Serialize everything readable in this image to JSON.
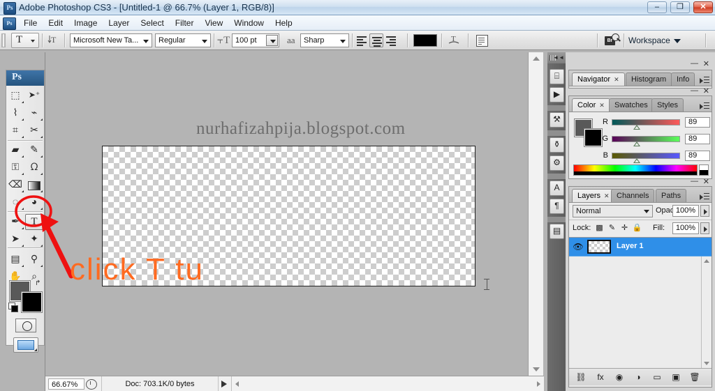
{
  "window": {
    "title": "Adobe Photoshop CS3 - [Untitled-1 @ 66.7% (Layer 1, RGB/8)]",
    "app_icon": "Ps",
    "minimize": "–",
    "restore": "❐",
    "close": "✕"
  },
  "menubar": {
    "app_icon": "Ps",
    "items": [
      "File",
      "Edit",
      "Image",
      "Layer",
      "Select",
      "Filter",
      "View",
      "Window",
      "Help"
    ]
  },
  "options_bar": {
    "tool_glyph": "T",
    "orientation_icon": "⇅T",
    "font_family": "Microsoft New Ta...",
    "font_style": "Regular",
    "size_icon": "⫟T",
    "font_size": "100 pt",
    "aa_icon": "aa",
    "anti_alias": "Sharp",
    "align_left": "align-left",
    "align_center": "align-center",
    "align_right": "align-right",
    "text_color": "#000000",
    "warp_icon": "warp-text",
    "palette_icon": "character-paragraph-panels",
    "bridge_label": "Br",
    "workspace_label": "Workspace"
  },
  "toolbox": {
    "header": "Ps",
    "tools": [
      {
        "name": "marquee-tool",
        "glyph": "▭",
        "menu": true,
        "selected": false
      },
      {
        "name": "move-tool",
        "glyph": "➤",
        "menu": false,
        "selected": false
      },
      {
        "name": "lasso-tool",
        "glyph": "✐",
        "menu": true,
        "selected": false
      },
      {
        "name": "magic-wand-tool",
        "glyph": "✧",
        "menu": true,
        "selected": false
      },
      {
        "name": "crop-tool",
        "glyph": "⌗",
        "menu": false,
        "selected": false
      },
      {
        "name": "slice-tool",
        "glyph": "✂",
        "menu": true,
        "selected": false
      },
      {
        "name": "healing-brush-tool",
        "glyph": "▰",
        "menu": true,
        "selected": false
      },
      {
        "name": "brush-tool",
        "glyph": "✎",
        "menu": true,
        "selected": false
      },
      {
        "name": "clone-stamp-tool",
        "glyph": "⚒",
        "menu": true,
        "selected": false
      },
      {
        "name": "history-brush-tool",
        "glyph": "ᘯ",
        "menu": true,
        "selected": false
      },
      {
        "name": "eraser-tool",
        "glyph": "◳",
        "menu": true,
        "selected": false
      },
      {
        "name": "gradient-tool",
        "glyph": "▤",
        "menu": true,
        "selected": false
      },
      {
        "name": "blur-tool",
        "glyph": "💧",
        "menu": true,
        "selected": false
      },
      {
        "name": "dodge-tool",
        "glyph": "◕",
        "menu": true,
        "selected": false
      },
      {
        "name": "pen-tool",
        "glyph": "✒",
        "menu": true,
        "selected": false
      },
      {
        "name": "type-tool",
        "glyph": "T",
        "menu": false,
        "selected": true
      },
      {
        "name": "path-selection-tool",
        "glyph": "➤",
        "menu": true,
        "selected": false
      },
      {
        "name": "shape-tool",
        "glyph": "✦",
        "menu": true,
        "selected": false
      },
      {
        "name": "notes-tool",
        "glyph": "▤",
        "menu": true,
        "selected": false
      },
      {
        "name": "eyedropper-tool",
        "glyph": "⚲",
        "menu": true,
        "selected": false
      },
      {
        "name": "hand-tool",
        "glyph": "✋",
        "menu": false,
        "selected": false
      },
      {
        "name": "zoom-tool",
        "glyph": "🔍",
        "menu": false,
        "selected": false
      }
    ],
    "foreground_color": "#595959",
    "background_color": "#000000",
    "swap_icon": "↱",
    "quick_mask_icon": "quick-mask",
    "screen_mode_icon": "screen-mode"
  },
  "document": {
    "watermark": "nurhafizahpija.blogspot.com",
    "zoom": "66.67%",
    "doc_info": "Doc: 703.1K/0 bytes"
  },
  "icon_dock": {
    "collapse_icon": "◄◄",
    "buttons": [
      {
        "name": "history-panel-icon",
        "glyph": "⌸"
      },
      {
        "name": "actions-panel-icon",
        "glyph": "▶"
      },
      {
        "name": "tool-presets-panel-icon",
        "glyph": "⚒"
      },
      {
        "name": "brushes-panel-icon",
        "glyph": "⚱"
      },
      {
        "name": "clone-source-panel-icon",
        "glyph": "⚙"
      },
      {
        "name": "character-panel-icon",
        "glyph": "A"
      },
      {
        "name": "paragraph-panel-icon",
        "glyph": "¶"
      },
      {
        "name": "layer-comps-panel-icon",
        "glyph": "▤"
      }
    ]
  },
  "navigator_panel": {
    "tabs": [
      "Navigator",
      "Histogram",
      "Info"
    ],
    "active": "Navigator",
    "close_glyph": "✕",
    "minimize_glyph": "—"
  },
  "color_panel": {
    "tabs": [
      "Color",
      "Swatches",
      "Styles"
    ],
    "active": "Color",
    "foreground_color": "#595959",
    "background_color": "#000000",
    "channels": [
      {
        "label": "R",
        "value": "89"
      },
      {
        "label": "G",
        "value": "89"
      },
      {
        "label": "B",
        "value": "89"
      }
    ],
    "close_glyph": "✕",
    "minimize_glyph": "—"
  },
  "layers_panel": {
    "tabs": [
      "Layers",
      "Channels",
      "Paths"
    ],
    "active": "Layers",
    "blend_mode": "Normal",
    "opacity_label": "Opacity:",
    "opacity_value": "100%",
    "lock_label": "Lock:",
    "lock_icons": [
      {
        "name": "lock-transparency-icon",
        "glyph": "▩"
      },
      {
        "name": "lock-image-icon",
        "glyph": "✎"
      },
      {
        "name": "lock-position-icon",
        "glyph": "✛"
      },
      {
        "name": "lock-all-icon",
        "glyph": "🔒"
      }
    ],
    "fill_label": "Fill:",
    "fill_value": "100%",
    "layers": [
      {
        "name": "Layer 1",
        "visible": true,
        "selected": true
      }
    ],
    "selected_color": "#2f8fe8",
    "footer_icons": [
      {
        "name": "link-layers-icon",
        "glyph": "⛓"
      },
      {
        "name": "layer-style-icon",
        "glyph": "fx"
      },
      {
        "name": "layer-mask-icon",
        "glyph": "◉"
      },
      {
        "name": "adjustment-layer-icon",
        "glyph": "◑"
      },
      {
        "name": "new-group-icon",
        "glyph": "▭"
      },
      {
        "name": "new-layer-icon",
        "glyph": "▣"
      },
      {
        "name": "delete-layer-icon",
        "glyph": "🗑"
      }
    ],
    "close_glyph": "✕",
    "minimize_glyph": "—"
  },
  "annotation": {
    "text": "click T tu",
    "color": "#ff6a20",
    "arrow_color": "#ee1111",
    "circle_color": "#ee1111"
  }
}
